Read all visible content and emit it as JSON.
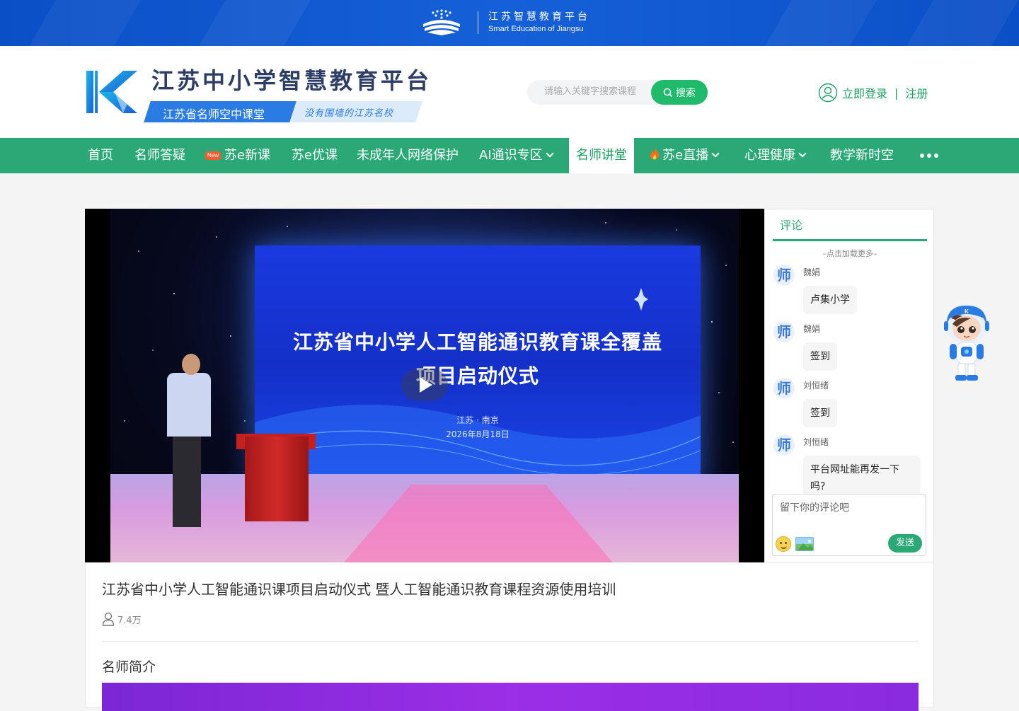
{
  "topbar": {
    "title_cn": "江苏智慧教育平台",
    "title_en": "Smart Education of Jiangsu"
  },
  "header": {
    "site_title": "江苏中小学智慧教育平台",
    "subtitle": "江苏省名师空中课堂",
    "slogan": "没有围墙的江苏名校",
    "search_placeholder": "请输入关键字搜索课程",
    "search_button": "搜索",
    "login": "立即登录",
    "login_sep": "|",
    "register": "注册"
  },
  "nav": {
    "new_tag": "New",
    "items": [
      "首页",
      "名师答疑",
      "苏e新课",
      "苏e优课",
      "未成年人网络保护",
      "AI通识专区",
      "名师讲堂",
      "苏e直播",
      "心理健康",
      "教学新时空"
    ],
    "active": "名师讲堂"
  },
  "video": {
    "screen_line1": "江苏省中小学人工智能通识教育课全覆盖",
    "screen_line2": "项目启动仪式",
    "screen_line3": "江苏 · 南京",
    "screen_line4": "2026年8月18日"
  },
  "comments": {
    "tab": "评论",
    "load_more": "–点击加载更多–",
    "avatar_char": "师",
    "items": [
      {
        "name": "魏娟",
        "text": "卢集小学"
      },
      {
        "name": "魏娟",
        "text": "签到"
      },
      {
        "name": "刘恒绪",
        "text": "签到"
      },
      {
        "name": "刘恒绪",
        "text": "平台网址能再发一下吗?"
      }
    ],
    "input_placeholder": "留下你的评论吧",
    "send": "发送"
  },
  "info": {
    "title": "江苏省中小学人工智能通识课项目启动仪式 暨人工智能通识教育课程资源使用培训",
    "views": "7.4万",
    "intro_heading": "名师简介"
  },
  "colors": {
    "brand_green": "#2aa876",
    "brand_blue": "#0b4fc6",
    "nav_bg": "#2aa876"
  }
}
